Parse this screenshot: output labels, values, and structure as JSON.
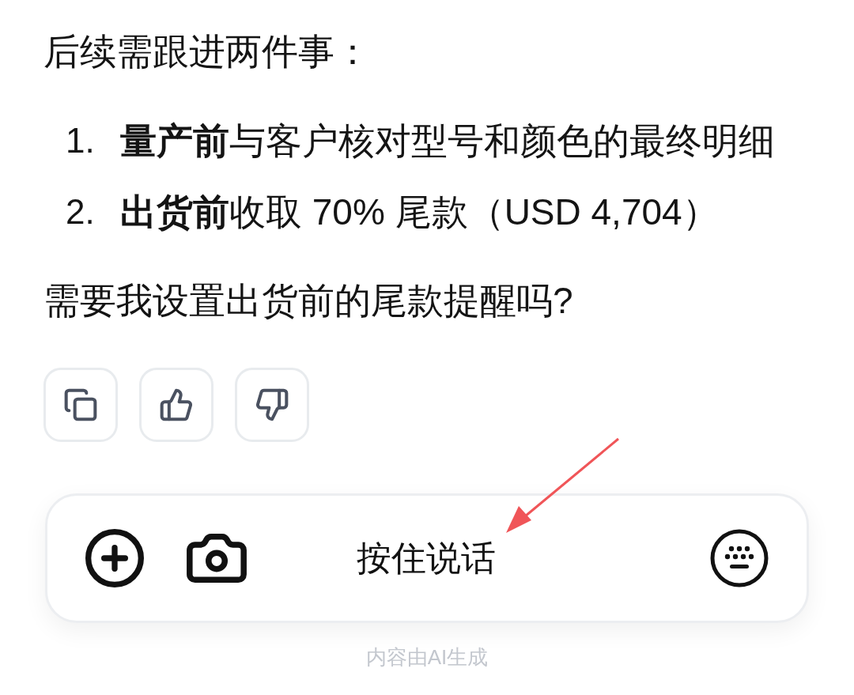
{
  "message": {
    "intro": "后续需跟进两件事：",
    "items": [
      {
        "number": "1.",
        "text": "**量产前**与客户核对型号和颜色的最终明细"
      },
      {
        "number": "2.",
        "text": "**出货前**收取 70% 尾款（USD 4,704）"
      }
    ],
    "question": "需要我设置出货前的尾款提醒吗?"
  },
  "input_bar": {
    "voice_button": "按住说话"
  },
  "footer": "内容由AI生成"
}
